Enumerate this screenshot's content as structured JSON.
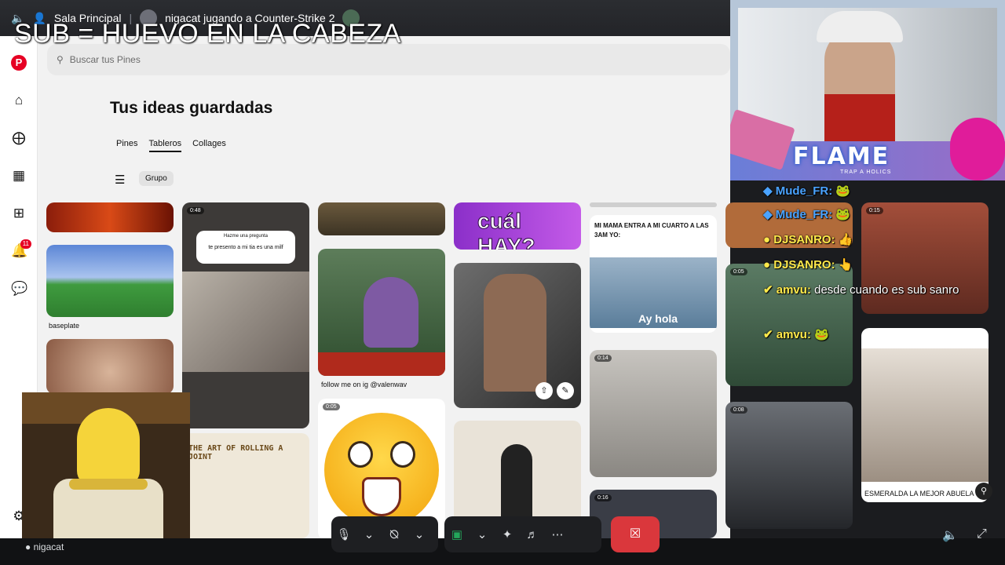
{
  "topbar": {
    "channel": "Sala Principal",
    "stream_title": "nigacat jugando a Counter-Strike 2"
  },
  "overlay_title": "SUB = HUEVO EN LA CABEZA",
  "pinterest": {
    "search_placeholder": "Buscar tus Pines",
    "page_title": "Tus ideas guardadas",
    "tabs": [
      "Pines",
      "Tableros",
      "Collages"
    ],
    "active_tab": "Tableros",
    "filter_chip": "Grupo",
    "notification_count": "11",
    "pins": {
      "baseplate_caption": "baseplate",
      "valenwav_caption": "follow me on ig @valenwav",
      "question_card": "Hazme una pregunta",
      "question_answer": "te presento a mi tia es una milf",
      "cual_hay": "cuál HAY?",
      "mama_text": "MI MAMA ENTRA A MI CUARTO A LAS 3AM YO:",
      "ay_hola": "Ay hola",
      "rolling": "THE ART OF ROLLING A JOINT",
      "esmeralda": "ESMERALDA LA MEJOR ABUELA",
      "durations": [
        "0:48",
        "0:05",
        "0:05",
        "0:14",
        "0:16",
        "0:15",
        "0:08"
      ]
    }
  },
  "webcam": {
    "brand": "FLAME",
    "tagline": "TRAP A HOLICS"
  },
  "chat": [
    {
      "user": "Mude_FR",
      "message": ""
    },
    {
      "user": "Mude_FR",
      "message": ""
    },
    {
      "user": "DJSANRO",
      "message": ""
    },
    {
      "user": "DJSANRO",
      "message": ""
    },
    {
      "user": "amvu",
      "message": "desde cuando es sub sanro"
    },
    {
      "user": "amvu",
      "message": ""
    }
  ],
  "bottom": {
    "username": "nigacat"
  },
  "colors": {
    "discord_bg": "#1e1f22",
    "leave_red": "#da373c",
    "pinterest_red": "#e60023",
    "chat_blue": "#4aa3ff",
    "chat_yellow": "#ffe94a",
    "screen_share_green": "#23a55a"
  }
}
